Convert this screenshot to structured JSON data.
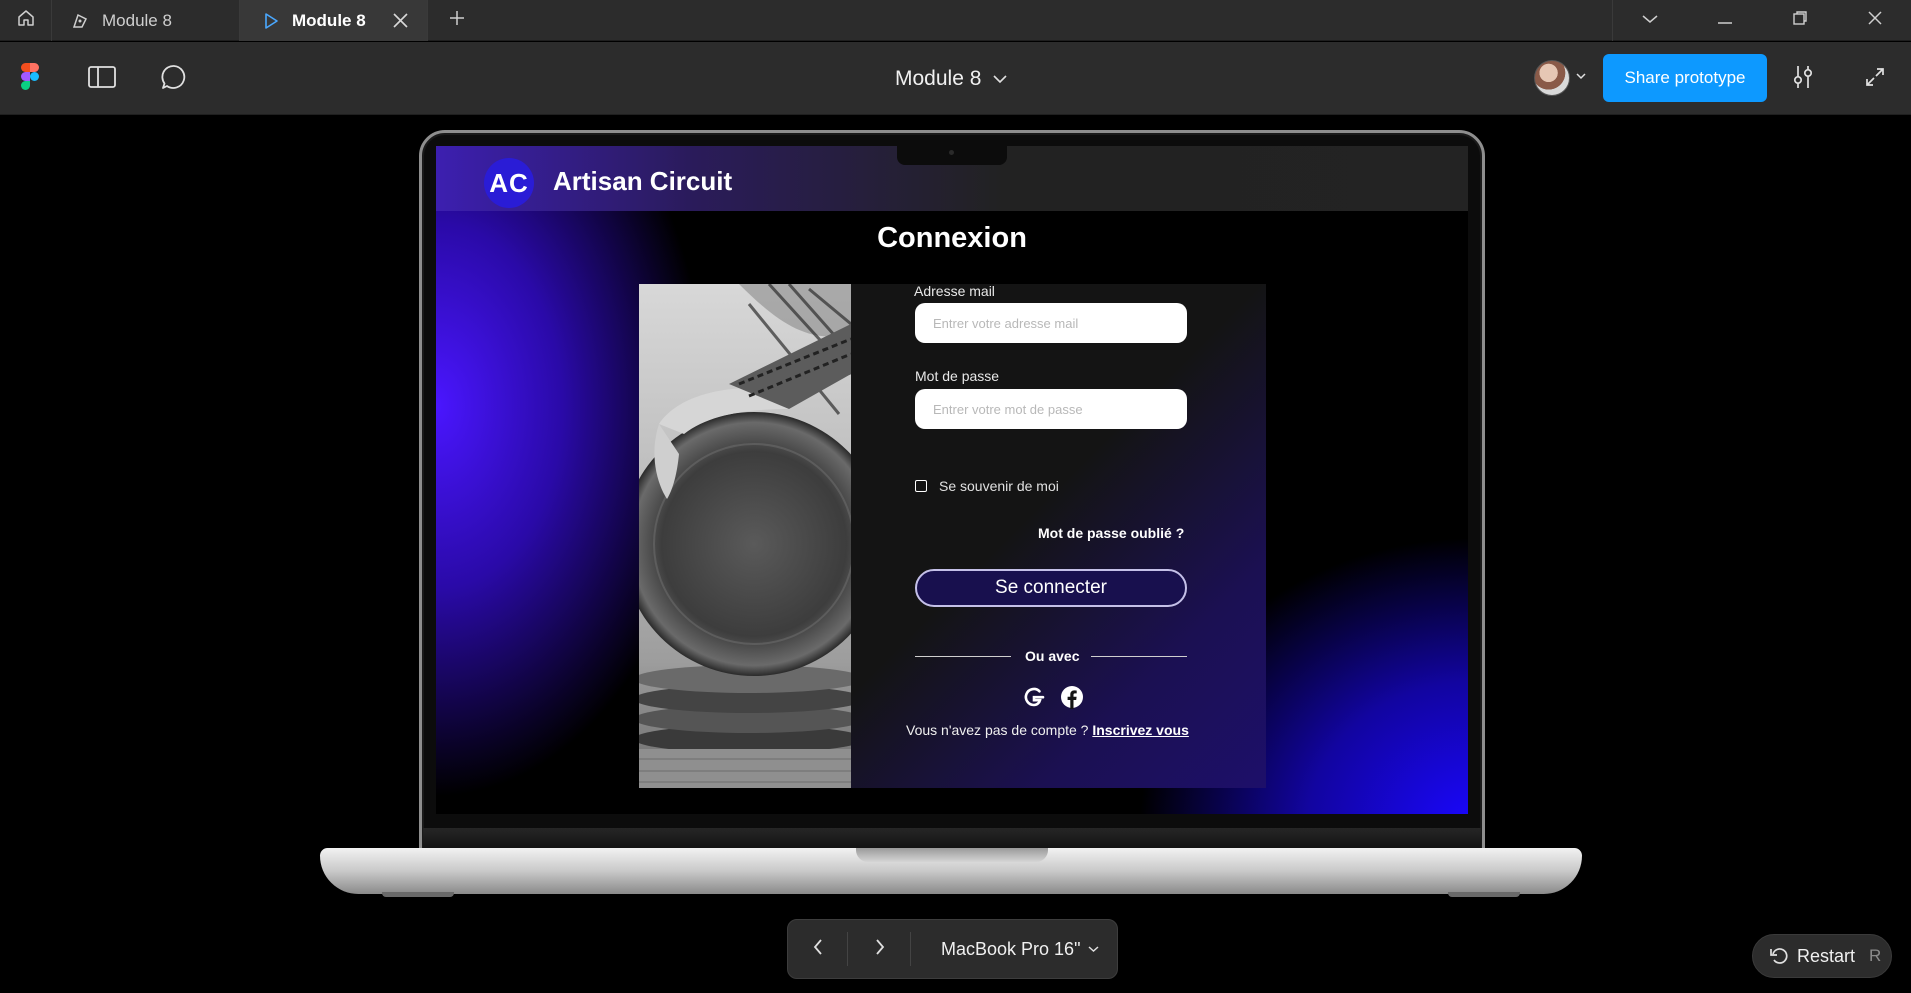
{
  "tabs": [
    {
      "label": "Module 8",
      "icon": "drawing-file-icon",
      "active": false
    },
    {
      "label": "Module 8",
      "icon": "play-icon",
      "active": true
    }
  ],
  "toolbar": {
    "document_title": "Module 8",
    "share_label": "Share prototype"
  },
  "prototype": {
    "logo_initials": "AC",
    "brand_name": "Artisan Circuit",
    "page_title": "Connexion",
    "email_label": "Adresse mail",
    "email_placeholder": "Entrer votre adresse mail",
    "password_label": "Mot de passe",
    "password_placeholder": "Entrer votre mot de passe",
    "remember_label": "Se souvenir de moi",
    "forgot_label": "Mot de passe oublié ?",
    "login_label": "Se connecter",
    "divider_label": "Ou avec",
    "signup_prompt": "Vous n'avez pas de compte ? ",
    "signup_link": "Inscrivez vous",
    "colors": {
      "accent": "#4a16ff",
      "button_bg": "#18104e",
      "share_blue": "#0d99ff"
    }
  },
  "device_bar": {
    "device_name": "MacBook Pro 16\""
  },
  "restart": {
    "label": "Restart",
    "shortcut": "R"
  }
}
